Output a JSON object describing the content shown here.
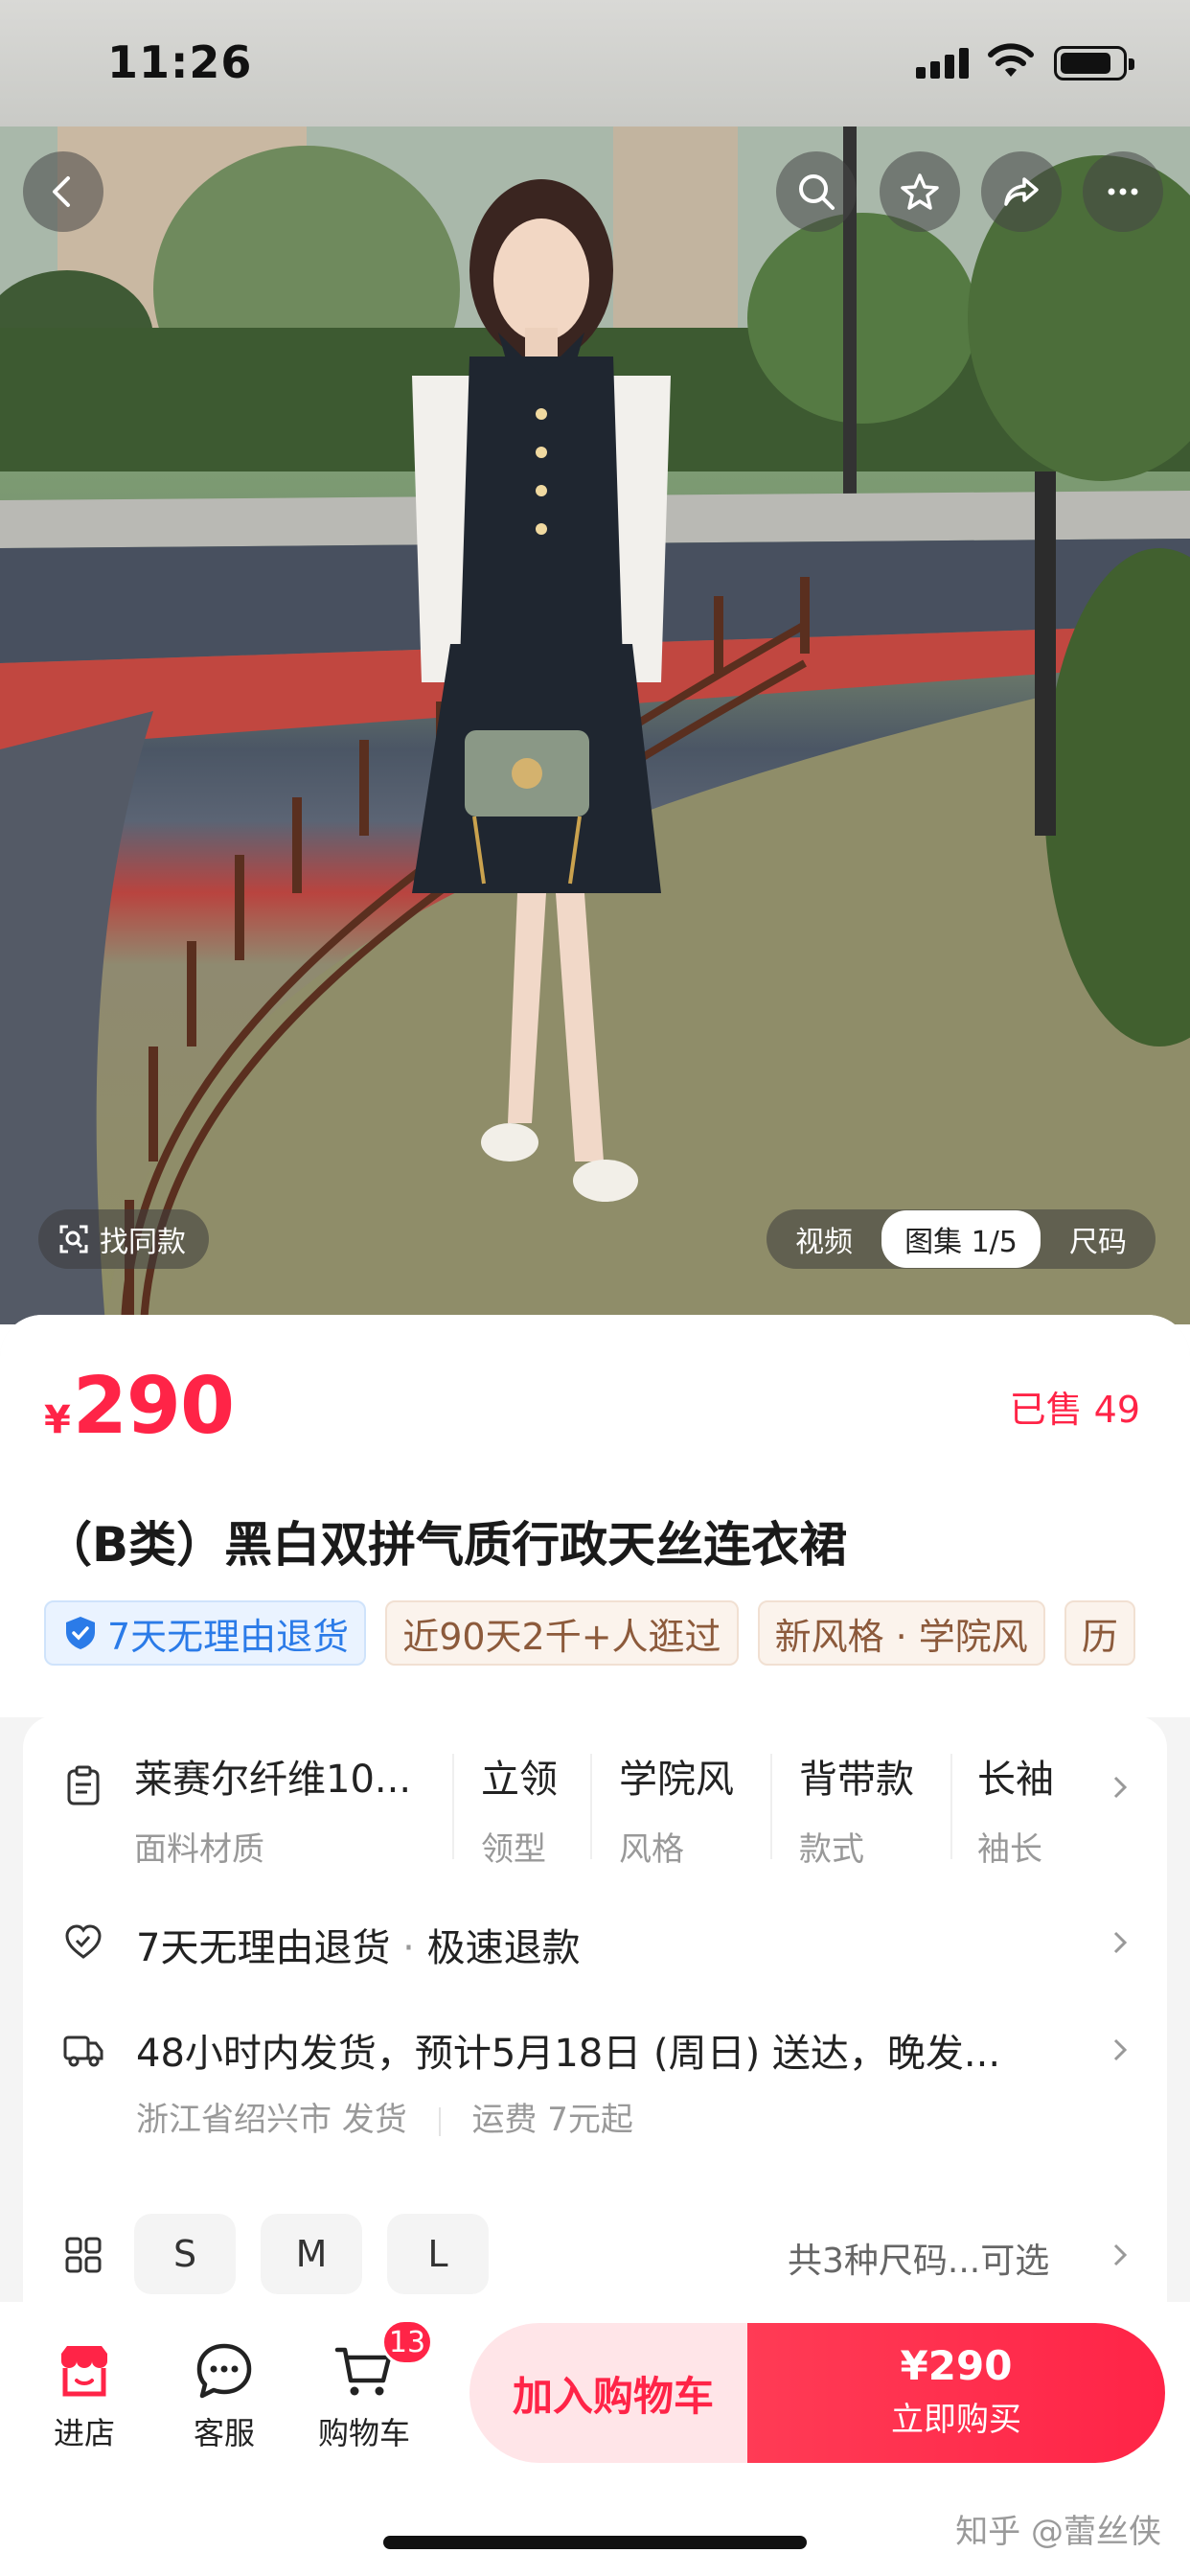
{
  "status_bar": {
    "time": "11:26"
  },
  "gallery": {
    "find_same_label": "找同款",
    "tabs": [
      "视频",
      "图集 1/5",
      "尺码"
    ]
  },
  "product": {
    "currency": "¥",
    "price": "290",
    "sold": "已售 49",
    "title": "（B类）黑白双拼气质行政天丝连衣裙",
    "tags": [
      "7天无理由退货",
      "近90天2千+人逛过",
      "新风格 · 学院风",
      "历"
    ]
  },
  "attributes": [
    {
      "value": "莱赛尔纤维10...",
      "key": "面料材质"
    },
    {
      "value": "立领",
      "key": "领型"
    },
    {
      "value": "学院风",
      "key": "风格"
    },
    {
      "value": "背带款",
      "key": "款式"
    },
    {
      "value": "长袖",
      "key": "袖长"
    }
  ],
  "returns": {
    "main": "7天无理由退货",
    "sep": " · ",
    "extra": "极速退款"
  },
  "shipping": {
    "main": "48小时内发货，预计5月18日 (周日) 送达，晚发...",
    "origin": "浙江省绍兴市 发货",
    "fee": "运费 7元起"
  },
  "sizes": {
    "options": [
      "S",
      "M",
      "L"
    ],
    "summary": "共3种尺码...可选"
  },
  "bottom_nav": {
    "shop": "进店",
    "service": "客服",
    "cart": "购物车",
    "cart_count": "13",
    "add_to_cart": "加入购物车",
    "buy_price": "¥290",
    "buy_now": "立即购买"
  },
  "watermark": "知乎 @蕾丝侠",
  "colors": {
    "accent": "#ff2447",
    "tag_blue": "#2b7be8",
    "tag_brown": "#8c5a3b"
  },
  "icons": [
    "back-icon",
    "search-icon",
    "star-icon",
    "share-icon",
    "more-icon",
    "scan-icon",
    "shield-icon",
    "clipboard-icon",
    "return-icon",
    "truck-icon",
    "grid-icon",
    "chevron-right-icon",
    "shop-icon",
    "chat-icon",
    "cart-icon"
  ]
}
